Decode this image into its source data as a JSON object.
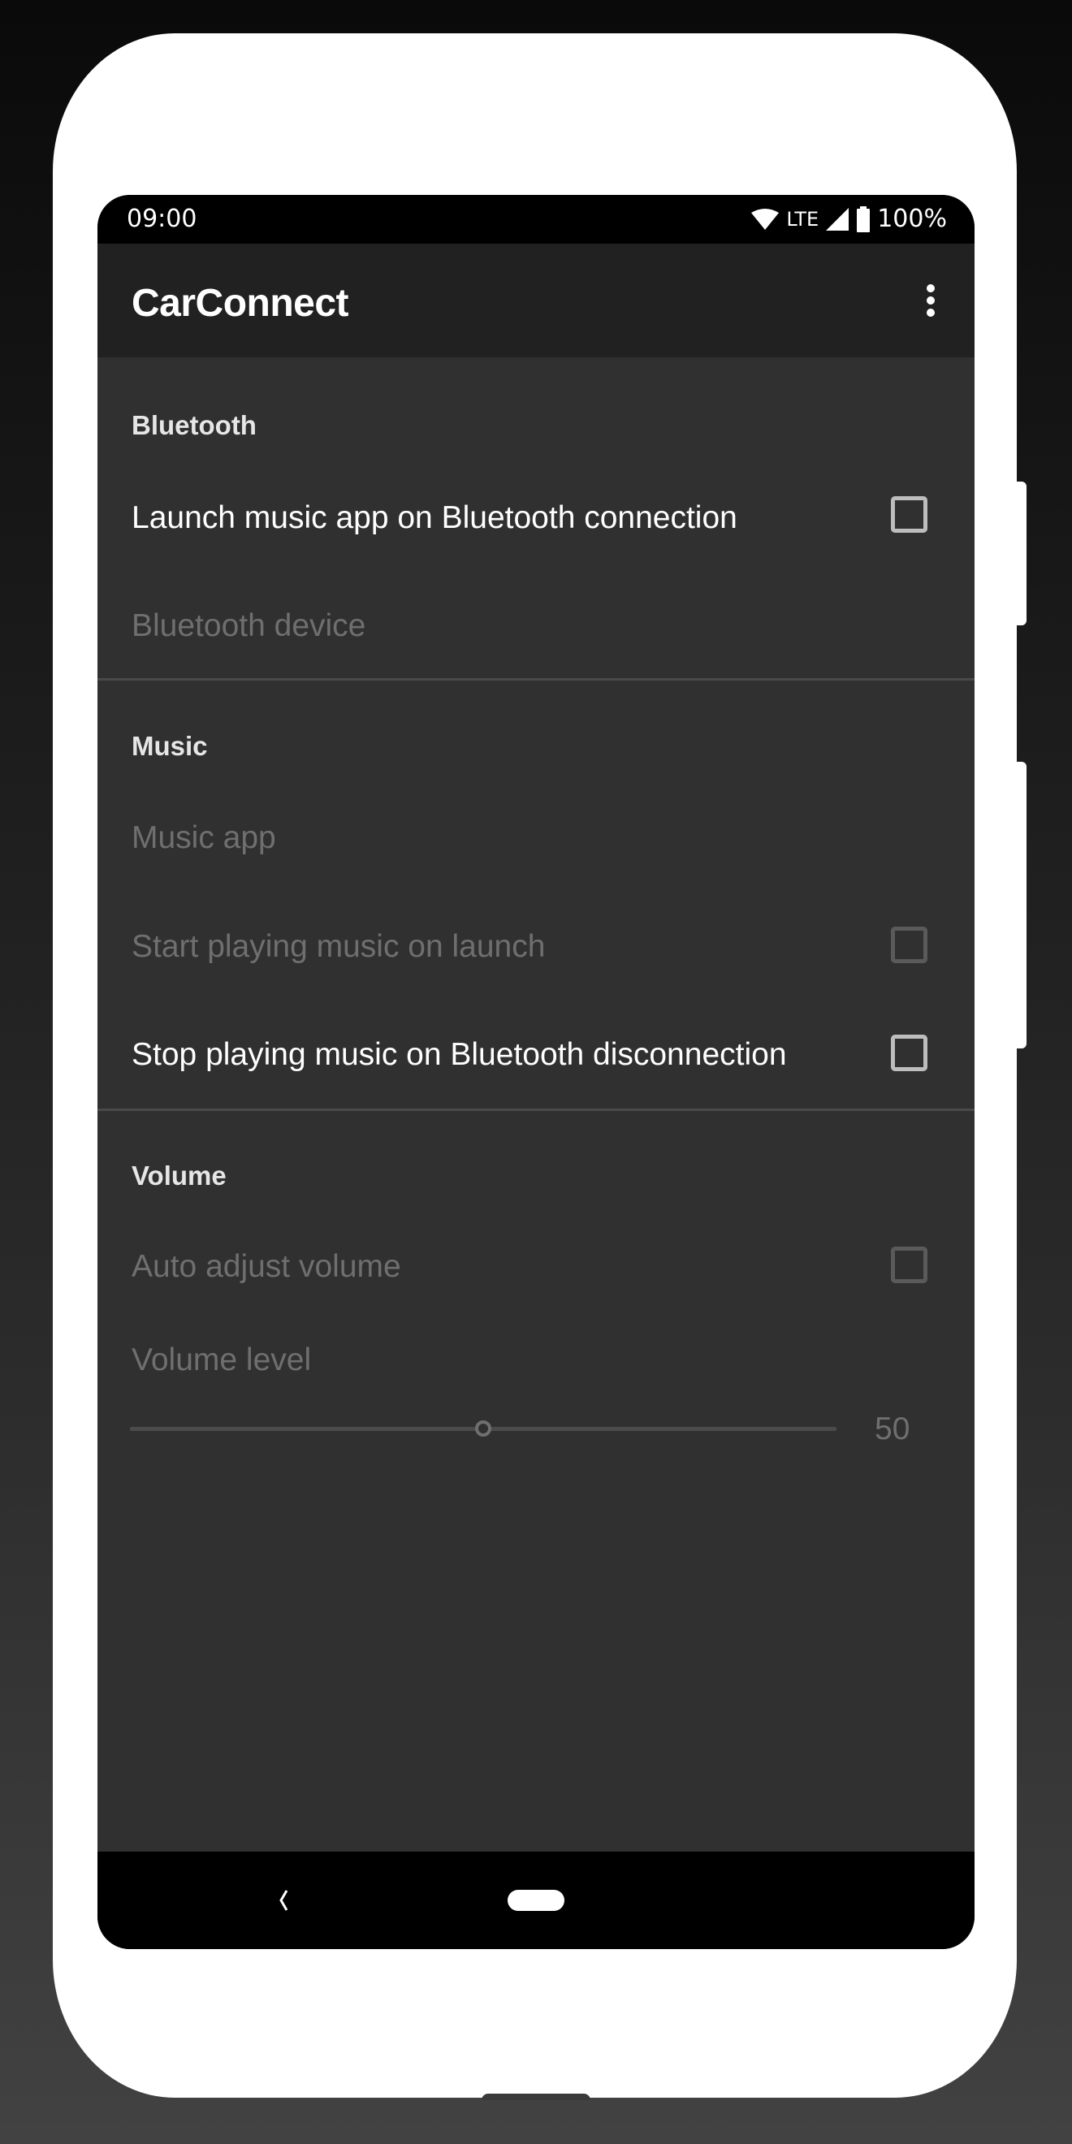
{
  "status_bar": {
    "time": "09:00",
    "network": "LTE",
    "battery": "100%",
    "icons": [
      "wifi-icon",
      "lte-icon",
      "signal-icon",
      "battery-icon"
    ]
  },
  "toolbar": {
    "title": "CarConnect",
    "overflow_icon": "more-vert-icon"
  },
  "categories": [
    {
      "header": "Bluetooth",
      "items": [
        {
          "title": "Launch music app on Bluetooth connection",
          "type": "checkbox",
          "checked": false,
          "enabled": true
        },
        {
          "title": "Bluetooth device",
          "type": "list",
          "enabled": false
        }
      ]
    },
    {
      "header": "Music",
      "items": [
        {
          "title": "Music app",
          "type": "list",
          "enabled": false
        },
        {
          "title": "Start playing music on launch",
          "type": "checkbox",
          "checked": false,
          "enabled": false
        },
        {
          "title": "Stop playing music on Bluetooth disconnection",
          "type": "checkbox",
          "checked": false,
          "enabled": true
        }
      ]
    },
    {
      "header": "Volume",
      "items": [
        {
          "title": "Auto adjust volume",
          "type": "checkbox",
          "checked": false,
          "enabled": false
        },
        {
          "title": "Volume level",
          "type": "seekbar",
          "enabled": false,
          "value": 50,
          "value_label": "50",
          "min": 0,
          "max": 100
        }
      ]
    }
  ],
  "nav_bar": {
    "back_icon": "back-chevron-icon",
    "home_icon": "home-pill-icon"
  }
}
